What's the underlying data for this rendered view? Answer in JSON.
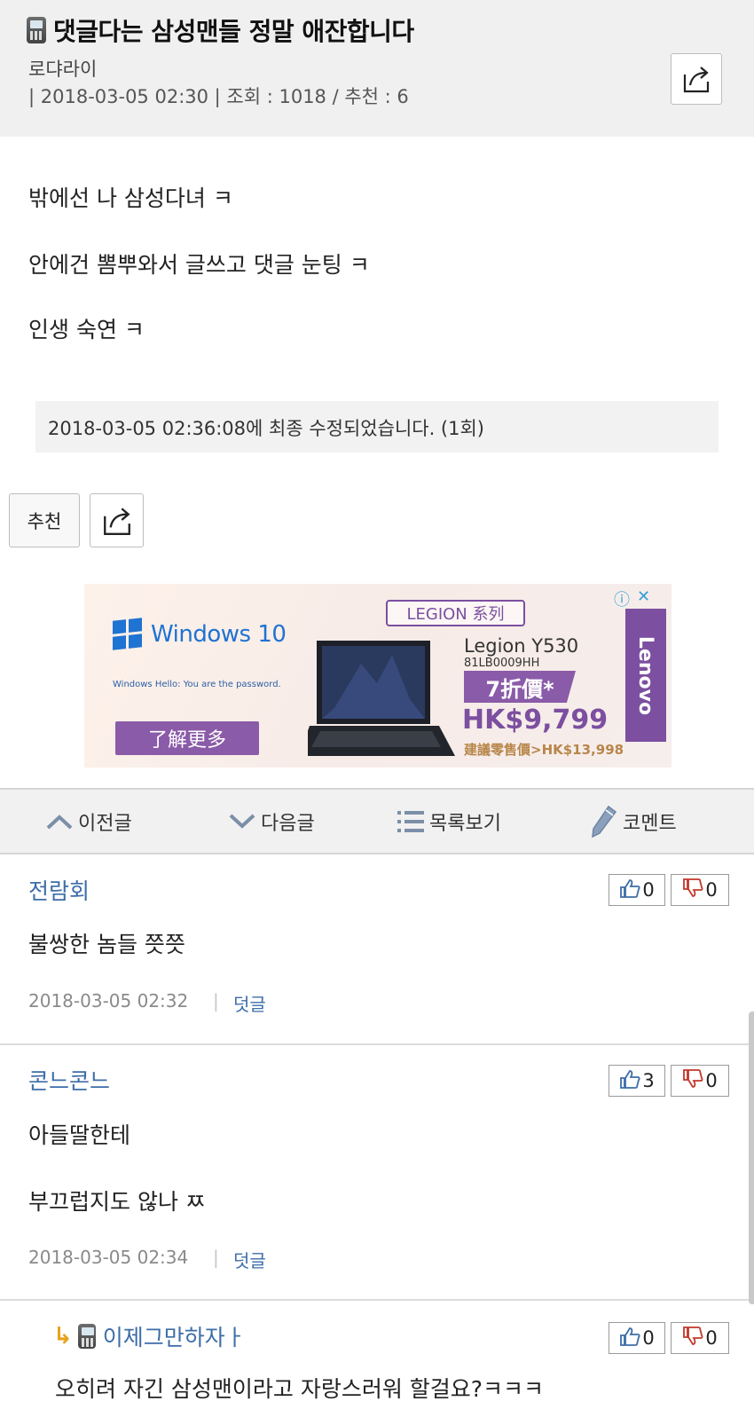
{
  "post": {
    "title": "댓글다는 삼성맨들 정말 애잔합니다",
    "author": "로댜라이",
    "meta": "| 2018-03-05 02:30 | 조회 : 1018 / 추천 : 6",
    "body_lines": [
      "밖에선 나 삼성다녀 ㅋ",
      "안에건 뽐뿌와서 글쓰고 댓글 눈팅 ㅋ",
      "인생 숙연 ㅋ"
    ],
    "edit_note": "2018-03-05 02:36:08에 최종 수정되었습니다. (1회)",
    "recommend_label": "추천",
    "share_icon": "share-icon",
    "device_icon": "phone-icon"
  },
  "ad": {
    "windows": "Windows 10",
    "hello": "Windows Hello: You are the password.",
    "cta": "了解更多",
    "legion": "LEGION 系列",
    "model": "Legion Y530",
    "model_code": "81LB0009HH",
    "discount": "7折價*",
    "price": "HK$9,799",
    "orig": "建議零售價>HK$13,998",
    "brand": "Lenovo",
    "info": "ⓘ",
    "close": "✕"
  },
  "nav": {
    "prev": "이전글",
    "next": "다음글",
    "list": "목록보기",
    "comment": "코멘트"
  },
  "comments": [
    {
      "author": "전람회",
      "lines": [
        "불쌍한 놈들 쯧쯧"
      ],
      "date": "2018-03-05 02:32",
      "sep": "|",
      "reply": "덧글",
      "up": "0",
      "down": "0"
    },
    {
      "author": "콘느콘느",
      "lines": [
        "아들딸한테",
        "부끄럽지도 않나 ㅉ"
      ],
      "date": "2018-03-05 02:34",
      "sep": "|",
      "reply": "덧글",
      "up": "3",
      "down": "0"
    },
    {
      "author": "이제그만하자ㅏ",
      "lines": [
        "오히려 자긴 삼성맨이라고 자랑스러워 할걸요?ㅋㅋㅋ"
      ],
      "up": "0",
      "down": "0",
      "reply_arrow": "↳"
    }
  ],
  "colors": {
    "header_bg": "#f0f0f0",
    "author_blue": "#3d6da8",
    "ad_purple": "#8a5ba8"
  }
}
